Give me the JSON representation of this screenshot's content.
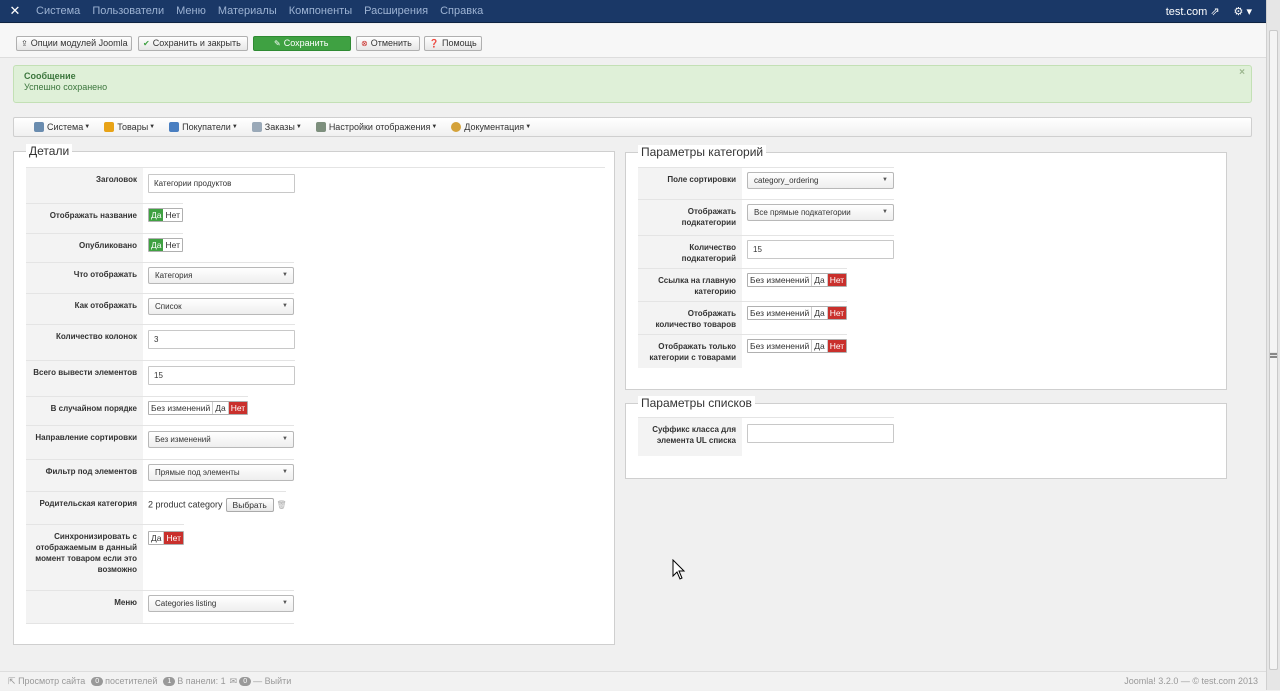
{
  "topbar": {
    "logo": "joomla-logo",
    "menu": [
      "Система",
      "Пользователи",
      "Меню",
      "Материалы",
      "Компоненты",
      "Расширения",
      "Справка"
    ],
    "site": "test.com",
    "accent": "#1a3867"
  },
  "toolbar": {
    "options": "Опции модулей Joomla",
    "save_close": "Сохранить и закрыть",
    "save": "Сохранить",
    "cancel": "Отменить",
    "help": "Помощь"
  },
  "message": {
    "heading": "Сообщение",
    "body": "Успешно сохранено",
    "close": "×"
  },
  "submenu": [
    "Система",
    "Товары",
    "Покупатели",
    "Заказы",
    "Настройки отображения",
    "Документация"
  ],
  "details": {
    "legend": "Детали",
    "title_label": "Заголовок",
    "title_value": "Категории продуктов",
    "show_name_label": "Отображать название",
    "yes": "Да",
    "no": "Нет",
    "published_label": "Опубликовано",
    "what_label": "Что отображать",
    "what_value": "Категория",
    "how_label": "Как отображать",
    "how_value": "Список",
    "columns_label": "Количество колонок",
    "columns_value": "3",
    "total_label": "Всего вывести элементов",
    "total_value": "15",
    "random_label": "В случайном порядке",
    "no_change": "Без изменений",
    "sort_dir_label": "Направление сортировки",
    "sort_dir_value": "Без изменений",
    "filter_label": "Фильтр под элементов",
    "filter_value": "Прямые под элементы",
    "parent_label": "Родительская категория",
    "parent_value": "2 product category",
    "choose": "Выбрать",
    "sync_label": "Синхронизировать с отображаемым в данный момент товаром если это возможно",
    "menu_label": "Меню",
    "menu_value": "Categories listing"
  },
  "category_params": {
    "legend": "Параметры категорий",
    "sort_field_label": "Поле сортировки",
    "sort_field_value": "category_ordering",
    "show_sub_label": "Отображать подкатегории",
    "show_sub_value": "Все прямые подкатегории",
    "sub_count_label": "Количество подкатегорий",
    "sub_count_value": "15",
    "link_main_label": "Ссылка на главную категорию",
    "show_count_label": "Отображать количество товаров",
    "only_with_label": "Отображать только категории с товарами",
    "no_change": "Без изменений",
    "yes": "Да",
    "no": "Нет"
  },
  "list_params": {
    "legend": "Параметры списков",
    "ul_suffix_label": "Суффикс класса для элемента UL списка",
    "ul_suffix_value": ""
  },
  "footer": {
    "view_site": "Просмотр сайта",
    "visitors_count": "0",
    "visitors": "посетителей",
    "panel_count": "1",
    "panel": "В панели: 1",
    "mail_count": "0",
    "logout": "Выйти",
    "version": "Joomla! 3.2.0 — © test.com 2013"
  }
}
